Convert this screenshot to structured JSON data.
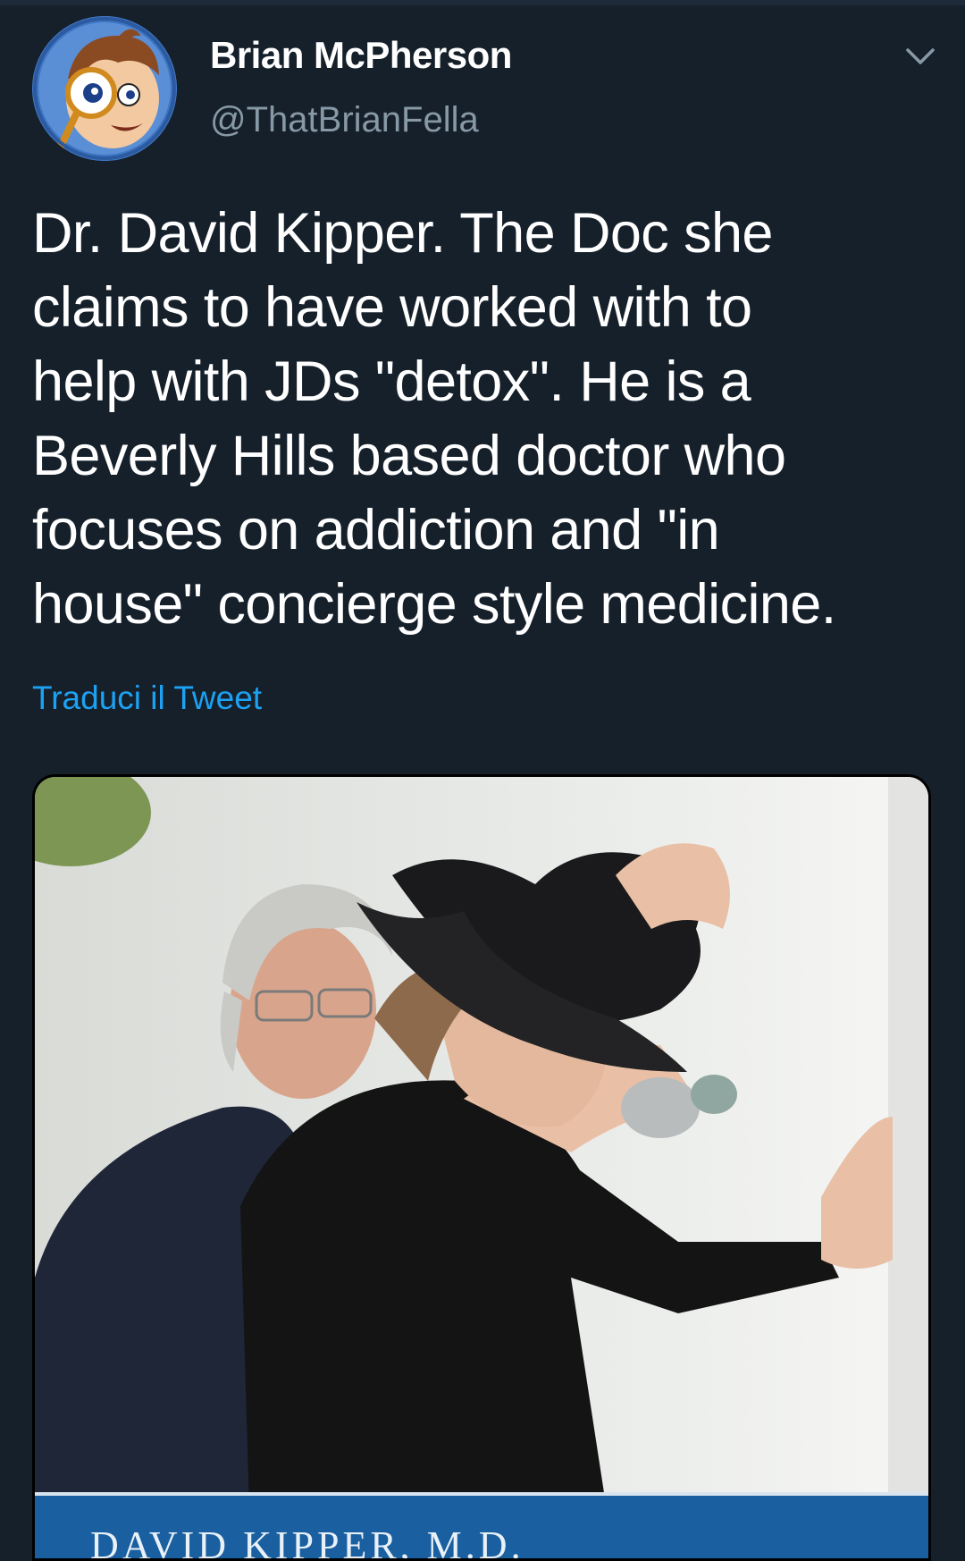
{
  "tweet": {
    "author_name": "Brian McPherson",
    "author_handle": "@ThatBrianFella",
    "text_lines": [
      "Dr. David Kipper.  The Doc she",
      "claims to have worked with to",
      "help with JDs \"detox\". He is a",
      "Beverly Hills based doctor who",
      "focuses on addiction and \"in",
      "house\" concierge style medicine."
    ],
    "translate_link": "Traduci il Tweet",
    "menu_icon": "chevron-down-icon",
    "avatar_icon": "cartoon-detective-avatar"
  },
  "media": {
    "caption": "DAVID KIPPER, M.D."
  },
  "colors": {
    "background": "#15202b",
    "text_primary": "#ffffff",
    "text_secondary": "#8899a6",
    "link": "#1da1f2",
    "caption_bar": "#1a5fa0"
  }
}
